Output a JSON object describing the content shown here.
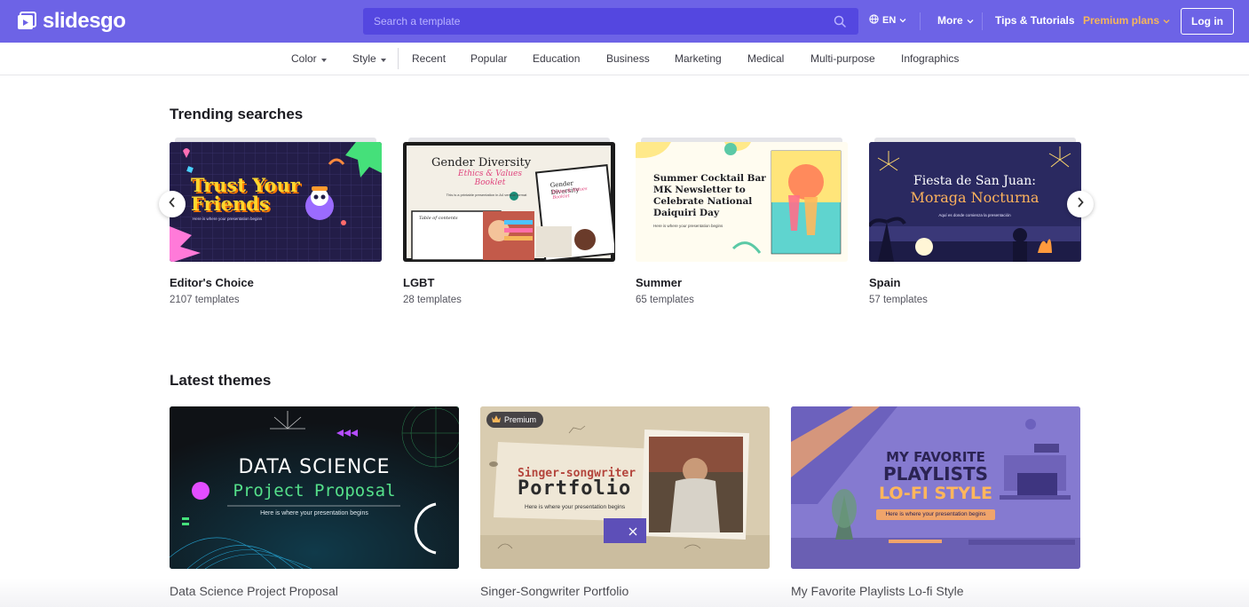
{
  "header": {
    "logo_text": "slidesgo",
    "search_placeholder": "Search a template",
    "language": "EN",
    "more_label": "More",
    "tips_label": "Tips & Tutorials",
    "premium_label": "Premium plans",
    "login_label": "Log in"
  },
  "categories": {
    "color": "Color",
    "style": "Style",
    "items": [
      "Recent",
      "Popular",
      "Education",
      "Business",
      "Marketing",
      "Medical",
      "Multi-purpose",
      "Infographics"
    ]
  },
  "trending": {
    "title": "Trending searches",
    "cards": [
      {
        "label": "Editor's Choice",
        "count": "2107 templates",
        "thumb_title": "Trust Your Friends",
        "thumb_sub": "Here is where your presentation begins"
      },
      {
        "label": "LGBT",
        "count": "28 templates",
        "thumb_title": "Gender Diversity",
        "thumb_sub": "Ethics & Values Booklet",
        "thumb_line": "This is a printable presentation in A4 vertical format",
        "thumb_mini_title": "Gender Diversity",
        "thumb_mini_sub": "Ethics & Values Booklet",
        "thumb_toc": "Table of contents"
      },
      {
        "label": "Summer",
        "count": "65 templates",
        "thumb_title": "Summer Cocktail Bar MK Newsletter to Celebrate National Daiquiri Day",
        "thumb_sub": "Here is where your presentation begins"
      },
      {
        "label": "Spain",
        "count": "57 templates",
        "thumb_title": "Fiesta de San Juan:",
        "thumb_title2": "Moraga Nocturna",
        "thumb_sub": "Aquí es donde comienza la presentación"
      }
    ]
  },
  "latest": {
    "title": "Latest themes",
    "premium_badge": "Premium",
    "cards": [
      {
        "title": "Data Science Project Proposal",
        "thumb_title": "DATA SCIENCE",
        "thumb_title2": "Project Proposal",
        "thumb_sub": "Here is where your presentation begins"
      },
      {
        "title": "Singer-Songwriter Portfolio",
        "thumb_title": "Singer-songwriter",
        "thumb_title2": "Portfolio",
        "thumb_sub": "Here is where your presentation begins"
      },
      {
        "title": "My Favorite Playlists Lo-fi Style",
        "thumb_title": "MY FAVORITE",
        "thumb_title2": "PLAYLISTS",
        "thumb_title3": "LO-FI STYLE",
        "thumb_sub": "Here is where your presentation begins"
      }
    ]
  },
  "colors": {
    "brand": "#6d63e6",
    "search_bg": "#5447e0",
    "premium": "#f6b65a"
  },
  "icons": [
    "slidesgo-logo-icon",
    "search-icon",
    "globe-icon",
    "chevron-down-icon",
    "caret-down-icon",
    "arrow-left-icon",
    "arrow-right-icon",
    "crown-icon",
    "close-icon"
  ]
}
